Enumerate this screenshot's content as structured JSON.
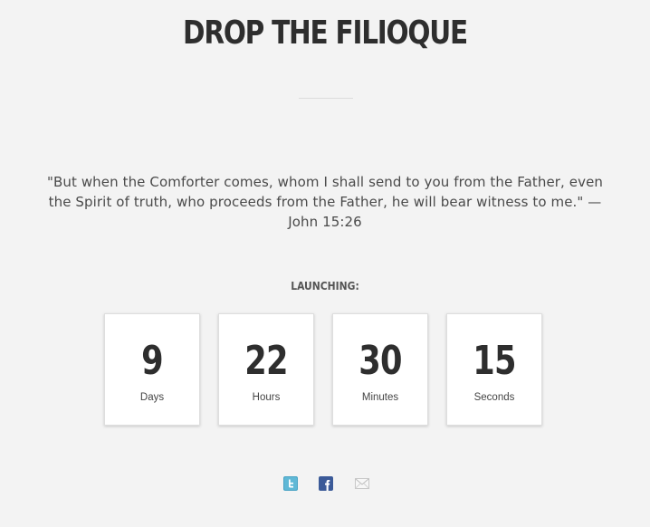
{
  "header": {
    "title": "DROP THE FILIOQUE"
  },
  "quote": {
    "text": "\"But when the Comforter comes, whom I shall send to you from the Father, even the Spirit of truth, who proceeds from the Father, he will bear witness to me.\" —John 15:26"
  },
  "countdown": {
    "heading": "LAUNCHING:",
    "units": [
      {
        "value": "9",
        "label": "Days"
      },
      {
        "value": "22",
        "label": "Hours"
      },
      {
        "value": "30",
        "label": "Minutes"
      },
      {
        "value": "15",
        "label": "Seconds"
      }
    ]
  },
  "social": {
    "icons": [
      "twitter-icon",
      "facebook-icon",
      "email-icon"
    ],
    "colors": {
      "twitter": "#5fb8d6",
      "facebook": "#3b5a98",
      "email": "#c8c8c8"
    }
  }
}
